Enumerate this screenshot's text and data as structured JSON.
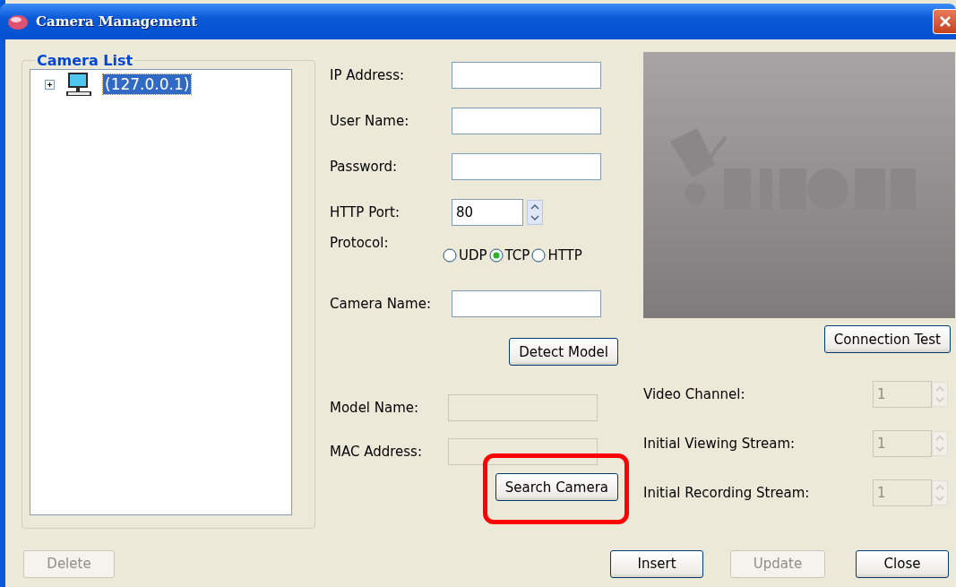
{
  "window": {
    "title": "Camera Management"
  },
  "camera_list": {
    "title": "Camera List",
    "tree": [
      {
        "label": "(127.0.0.1)",
        "expanded": false,
        "selected": true
      }
    ]
  },
  "connection": {
    "fields": [
      {
        "kind": "text",
        "label": "IP Address:"
      },
      {
        "kind": "text",
        "label": "User Name:"
      },
      {
        "kind": "text",
        "label": "Password:"
      },
      {
        "kind": "spin",
        "label": "HTTP Port:",
        "value": "80"
      },
      {
        "kind": "radio",
        "label": "Protocol:",
        "options": [
          {
            "label": "UDP",
            "selected": false
          },
          {
            "label": "TCP",
            "selected": true
          },
          {
            "label": "HTTP",
            "selected": false
          }
        ]
      },
      {
        "kind": "text",
        "label": "Camera Name:"
      }
    ],
    "detect_button": {
      "label": "Detect Model"
    }
  },
  "model": {
    "fields": [
      {
        "label": "Model Name:",
        "disabled": true
      },
      {
        "label": "MAC Address:",
        "disabled": true
      }
    ],
    "search_button": {
      "label": "Search Camera",
      "highlighted": true
    }
  },
  "connection_test_button": {
    "label": "Connection Test"
  },
  "stream_settings": [
    {
      "label": "Video Channel:",
      "value": "1",
      "disabled": true
    },
    {
      "label": "Initial Viewing Stream:",
      "value": "1",
      "disabled": true
    },
    {
      "label": "Initial Recording Stream:",
      "value": "1",
      "disabled": true
    }
  ],
  "buttons": [
    {
      "label": "Delete",
      "disabled": true
    },
    {
      "label": "Insert",
      "disabled": false
    },
    {
      "label": "Update",
      "disabled": true
    },
    {
      "label": "Close",
      "disabled": false
    }
  ]
}
